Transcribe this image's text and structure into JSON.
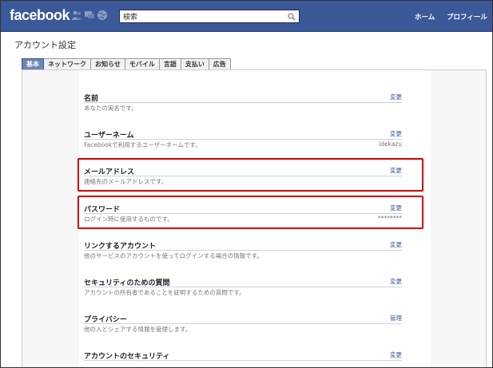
{
  "topbar": {
    "logo": "facebook",
    "search": {
      "value": "検索",
      "placeholder": ""
    },
    "links": [
      "ホーム",
      "プロフィール"
    ]
  },
  "page": {
    "title": "アカウント設定",
    "tabs": [
      "基本",
      "ネットワーク",
      "お知らせ",
      "モバイル",
      "言語",
      "支払い",
      "広告"
    ]
  },
  "settings": [
    {
      "title": "名前",
      "desc": "あなたの実名です。",
      "action": "変更",
      "value": ""
    },
    {
      "title": "ユーザーネーム",
      "desc": "Facebookで利用するユーザーネームです。",
      "action": "変更",
      "value": "idekazu"
    },
    {
      "title": "メールアドレス",
      "desc": "連絡先のメールアドレスです。",
      "action": "変更",
      "value": ""
    },
    {
      "title": "パスワード",
      "desc": "ログイン時に使用するものです。",
      "action": "変更",
      "value": "********"
    },
    {
      "title": "リンクするアカウント",
      "desc": "他のサービスのアカウントを使ってログインする場合の情報です。",
      "action": "変更",
      "value": ""
    },
    {
      "title": "セキュリティのための質問",
      "desc": "アカウントの所有者であることを証明するための質問です。",
      "action": "変更",
      "value": ""
    },
    {
      "title": "プライバシー",
      "desc": "他の人とシェアする情報を管理します。",
      "action": "管理",
      "value": ""
    },
    {
      "title": "アカウントのセキュリティ",
      "desc": "",
      "action": "変更",
      "value": ""
    }
  ],
  "colors": {
    "brand": "#3b5998",
    "highlight": "#d40000"
  }
}
